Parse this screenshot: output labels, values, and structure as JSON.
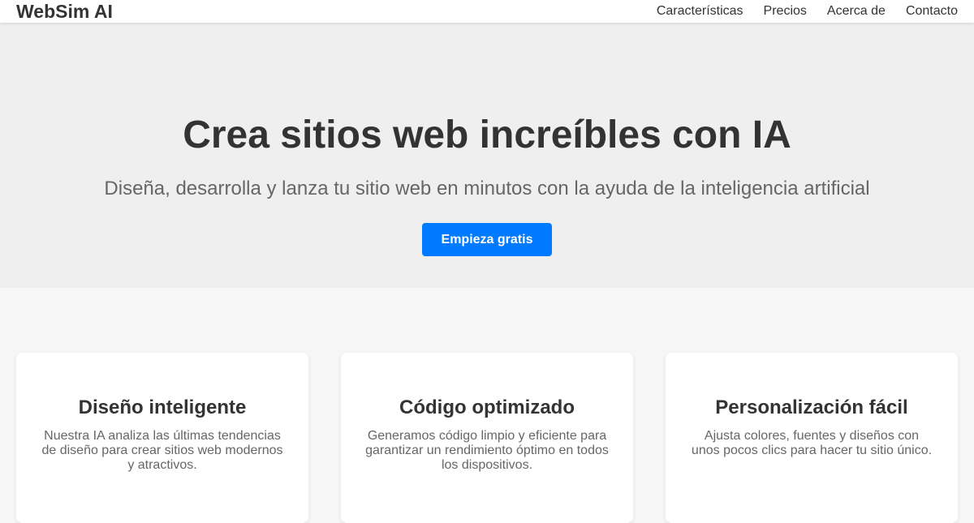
{
  "header": {
    "logo": "WebSim AI",
    "nav": [
      "Características",
      "Precios",
      "Acerca de",
      "Contacto"
    ]
  },
  "hero": {
    "title": "Crea sitios web increíbles con IA",
    "subtitle": "Diseña, desarrolla y lanza tu sitio web en minutos con la ayuda de la inteligencia artificial",
    "cta_label": "Empieza gratis"
  },
  "features": [
    {
      "title": "Diseño inteligente",
      "description": "Nuestra IA analiza las últimas tendencias de diseño para crear sitios web modernos y atractivos."
    },
    {
      "title": "Código optimizado",
      "description": "Generamos código limpio y eficiente para garantizar un rendimiento óptimo en todos los dispositivos."
    },
    {
      "title": "Personalización fácil",
      "description": "Ajusta colores, fuentes y diseños con unos pocos clics para hacer tu sitio único."
    }
  ],
  "colors": {
    "accent": "#007bff",
    "text": "#333333",
    "muted_text": "#666666",
    "hero_background": "#efefef",
    "page_background": "#f6f6f6",
    "card_background": "#ffffff"
  }
}
